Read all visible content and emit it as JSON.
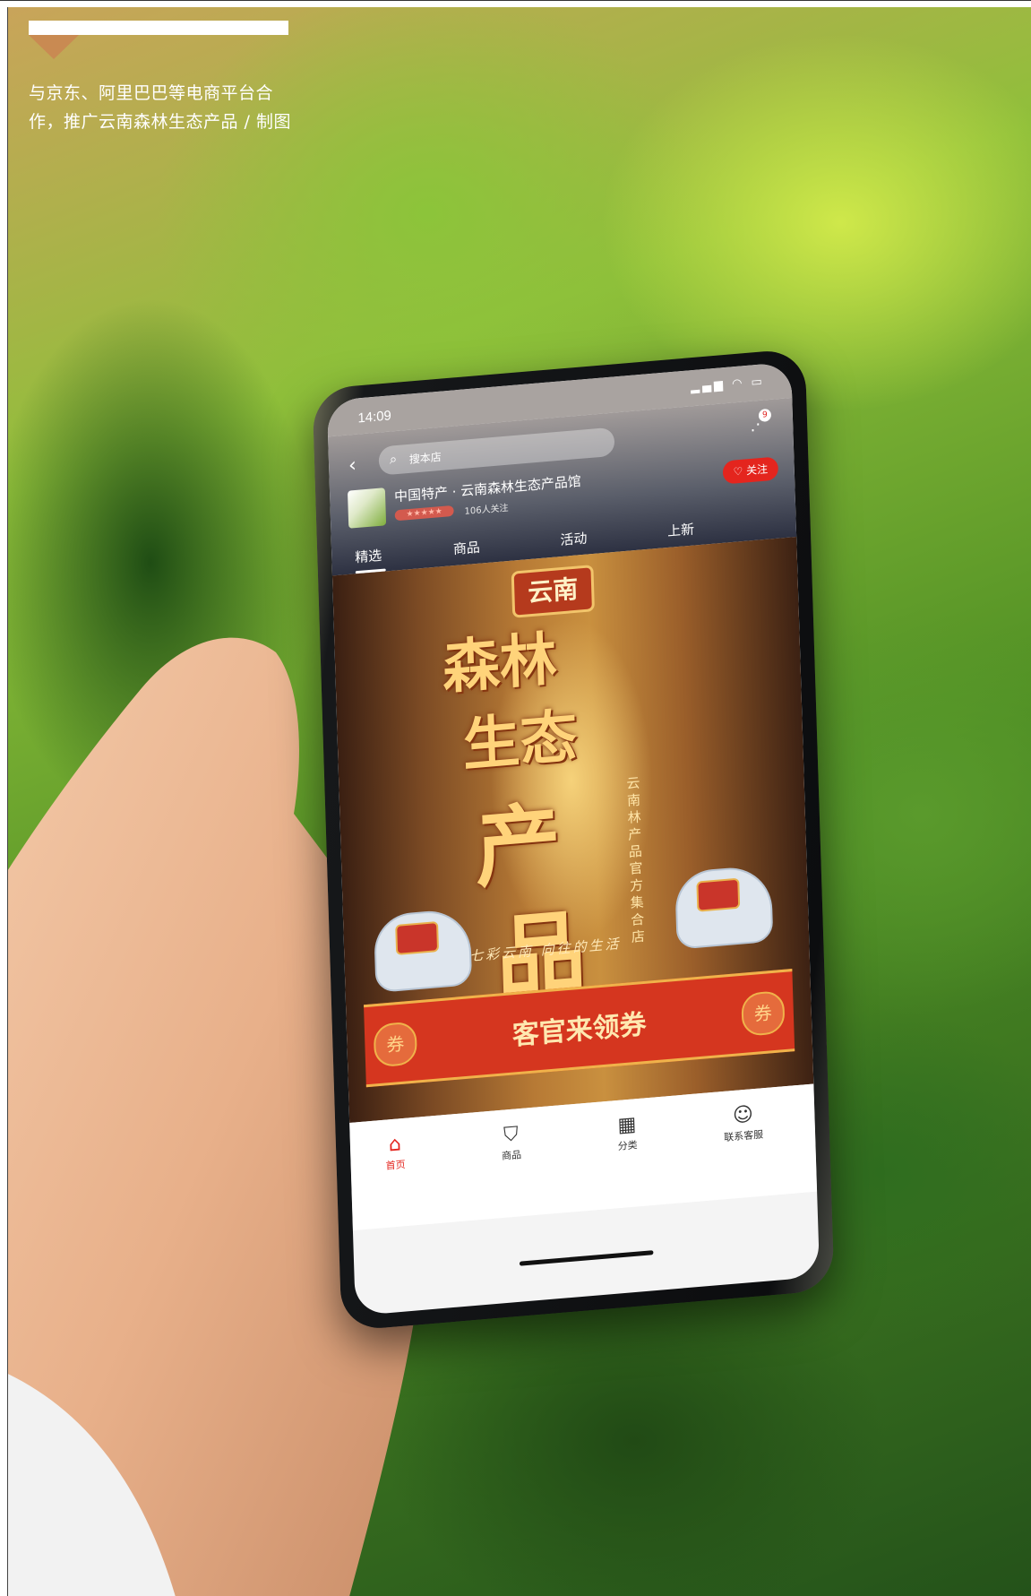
{
  "caption": {
    "text": "与京东、阿里巴巴等电商平台合作，推广云南森林生态产品 / 制图"
  },
  "phone": {
    "status_time": "14:09",
    "search_placeholder": "搜本店",
    "cart_badge": "9",
    "store_name": "中国特产 · 云南森林生态产品馆",
    "store_followers": "106人关注",
    "follow_label": "关注",
    "tabs": [
      "精选",
      "商品",
      "活动",
      "上新"
    ],
    "banner": {
      "badge": "云南",
      "line1": "森林",
      "line2": "生态",
      "line3": "产",
      "line4": "品",
      "vertical_text": "云南林产品官方集合店",
      "slogan": "七彩云南 向往的生活",
      "coupon_text": "客官来领券",
      "coupon_seal": "券"
    },
    "bottom_nav": [
      {
        "label": "首页",
        "icon": "home-icon"
      },
      {
        "label": "商品",
        "icon": "bag-icon"
      },
      {
        "label": "分类",
        "icon": "grid-icon"
      },
      {
        "label": "联系客服",
        "icon": "chat-icon"
      }
    ]
  },
  "colors": {
    "accent_red": "#e4251e",
    "caption_arrow": "#c98a52",
    "foliage_green": "#4f8f24"
  }
}
